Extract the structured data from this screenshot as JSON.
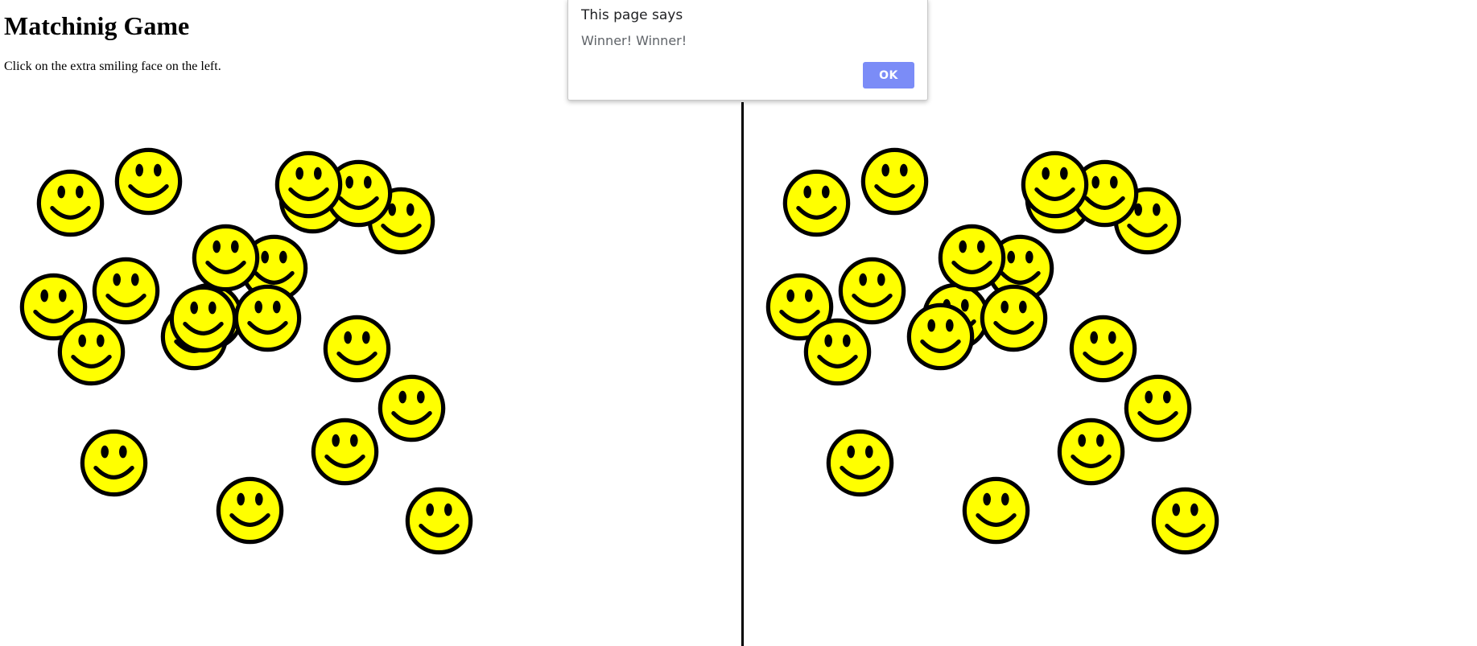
{
  "page": {
    "title": "Matchinig Game",
    "instructions": "Click on the extra smiling face on the left."
  },
  "dialog": {
    "title": "This page says",
    "message": "Winner! Winner!",
    "ok_label": "OK"
  },
  "game": {
    "face_icon": "smiley-face-icon",
    "face_color": "#ffff00",
    "outline_color": "#000000",
    "left_face_count": 23,
    "right_face_count": 22
  }
}
